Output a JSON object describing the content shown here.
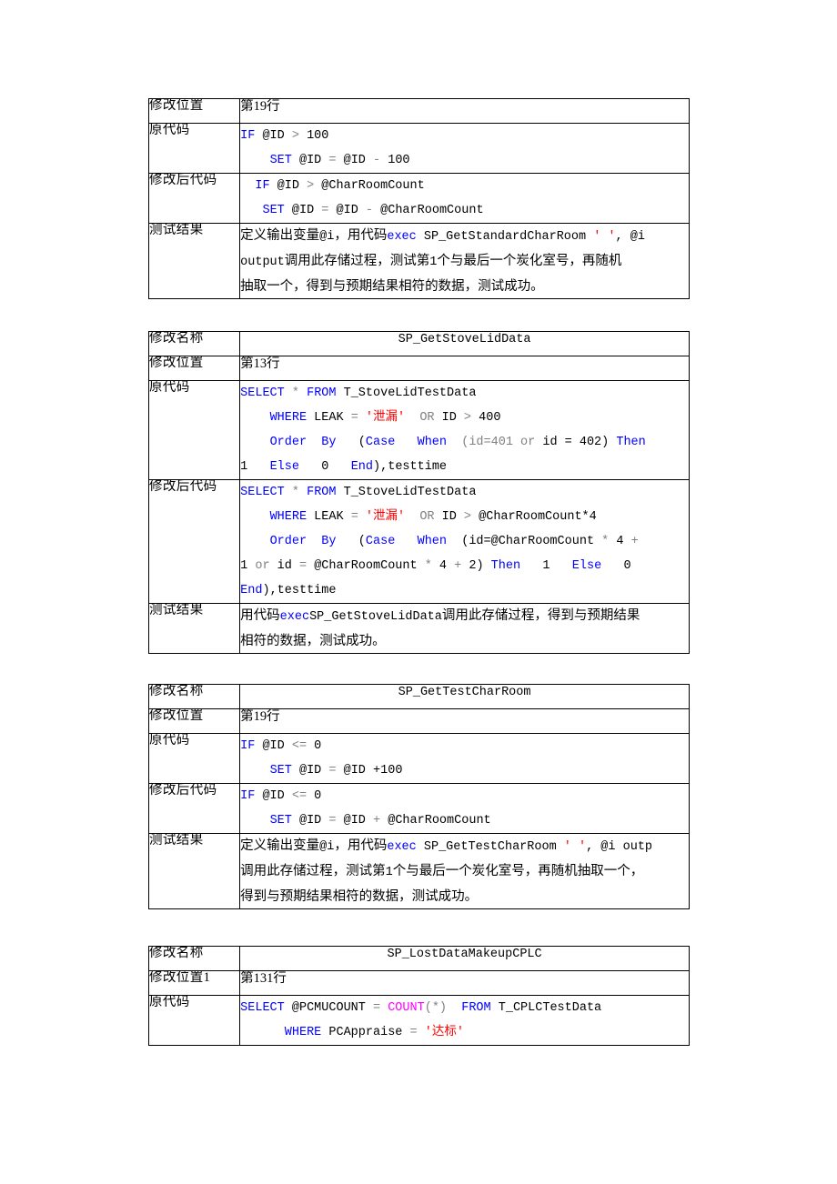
{
  "document": {
    "page_background": "#ffffff",
    "code_colors": {
      "keyword": "#0000ff",
      "string": "#ff0000",
      "operator": "#808080",
      "function": "#ff00ff",
      "plain": "#000000"
    }
  },
  "labels": {
    "name": "修改名称",
    "position": "修改位置",
    "position1": "修改位置1",
    "original_code": "原代码",
    "modified_code": "修改后代码",
    "test_result": "测试结果"
  },
  "tables": [
    {
      "id": "table-1",
      "rows": {
        "position_value": "第19行",
        "original_code_lines": [
          [
            {
              "t": "IF",
              "c": "kw"
            },
            {
              "t": " @ID ",
              "c": "txt"
            },
            {
              "t": ">",
              "c": "op"
            },
            {
              "t": " 100",
              "c": "txt"
            }
          ],
          [
            {
              "t": "    ",
              "c": "txt"
            },
            {
              "t": "SET",
              "c": "kw"
            },
            {
              "t": " @ID ",
              "c": "txt"
            },
            {
              "t": "=",
              "c": "op"
            },
            {
              "t": " @ID ",
              "c": "txt"
            },
            {
              "t": "-",
              "c": "op"
            },
            {
              "t": " 100",
              "c": "txt"
            }
          ]
        ],
        "modified_code_lines": [
          [
            {
              "t": "  ",
              "c": "txt"
            },
            {
              "t": "IF",
              "c": "kw"
            },
            {
              "t": " @ID ",
              "c": "txt"
            },
            {
              "t": ">",
              "c": "op"
            },
            {
              "t": " @CharRoomCount",
              "c": "txt"
            }
          ],
          [
            {
              "t": "   ",
              "c": "txt"
            },
            {
              "t": "SET",
              "c": "kw"
            },
            {
              "t": " @ID ",
              "c": "txt"
            },
            {
              "t": "=",
              "c": "op"
            },
            {
              "t": " @ID ",
              "c": "txt"
            },
            {
              "t": "-",
              "c": "op"
            },
            {
              "t": " @CharRoomCount",
              "c": "txt"
            }
          ]
        ],
        "test_result_lines": [
          [
            {
              "t": "定义输出变量",
              "k": "cn"
            },
            {
              "t": "@i",
              "k": "mono"
            },
            {
              "t": "，用代码",
              "k": "cn"
            },
            {
              "t": "exec",
              "k": "kw"
            },
            {
              "t": " SP_GetStandardCharRoom ",
              "k": "mono"
            },
            {
              "t": "' '",
              "k": "str"
            },
            {
              "t": ", @i",
              "k": "mono"
            }
          ],
          [
            {
              "t": "output",
              "k": "mono"
            },
            {
              "t": "调用此存储过程，测试第",
              "k": "cn"
            },
            {
              "t": "1",
              "k": "mono"
            },
            {
              "t": "个与最后一个炭化室号，再随机",
              "k": "cn"
            }
          ],
          [
            {
              "t": "抽取一个，得到与预期结果相符的数据，测试成功。",
              "k": "cn"
            }
          ]
        ]
      }
    },
    {
      "id": "table-2",
      "rows": {
        "name_value": "SP_GetStoveLidData",
        "position_value": "第13行",
        "original_code_lines": [
          [
            {
              "t": "SELECT",
              "c": "kw"
            },
            {
              "t": " ",
              "c": "txt"
            },
            {
              "t": "*",
              "c": "op"
            },
            {
              "t": " ",
              "c": "txt"
            },
            {
              "t": "FROM",
              "c": "kw"
            },
            {
              "t": " T_StoveLidTestData",
              "c": "txt"
            }
          ],
          [
            {
              "t": "    ",
              "c": "txt"
            },
            {
              "t": "WHERE",
              "c": "kw"
            },
            {
              "t": " LEAK ",
              "c": "txt"
            },
            {
              "t": "=",
              "c": "op"
            },
            {
              "t": " ",
              "c": "txt"
            },
            {
              "t": "'泄漏'",
              "c": "str"
            },
            {
              "t": "  ",
              "c": "txt"
            },
            {
              "t": "OR",
              "c": "op"
            },
            {
              "t": " ID ",
              "c": "txt"
            },
            {
              "t": ">",
              "c": "op"
            },
            {
              "t": " 400",
              "c": "txt"
            }
          ],
          [
            {
              "t": "    ",
              "c": "txt"
            },
            {
              "t": "Order",
              "c": "kw"
            },
            {
              "t": "  ",
              "c": "txt"
            },
            {
              "t": "By",
              "c": "kw"
            },
            {
              "t": "   (",
              "c": "txt"
            },
            {
              "t": "Case",
              "c": "kw"
            },
            {
              "t": "   ",
              "c": "txt"
            },
            {
              "t": "When",
              "c": "kw"
            },
            {
              "t": "  (",
              "c": "op"
            },
            {
              "t": "id=401",
              "c": "op"
            },
            {
              "t": " or ",
              "c": "op"
            },
            {
              "t": "id = 402",
              "c": "txt"
            },
            {
              "t": ") ",
              "c": "txt"
            },
            {
              "t": "Then",
              "c": "kw"
            }
          ],
          [
            {
              "t": "1",
              "c": "txt"
            },
            {
              "t": "   ",
              "c": "txt"
            },
            {
              "t": "Else",
              "c": "kw"
            },
            {
              "t": "   0",
              "c": "txt"
            },
            {
              "t": "   ",
              "c": "txt"
            },
            {
              "t": "End",
              "c": "kw"
            },
            {
              "t": "),testtime",
              "c": "txt"
            }
          ]
        ],
        "modified_code_lines": [
          [
            {
              "t": "SELECT",
              "c": "kw"
            },
            {
              "t": " ",
              "c": "txt"
            },
            {
              "t": "*",
              "c": "op"
            },
            {
              "t": " ",
              "c": "txt"
            },
            {
              "t": "FROM",
              "c": "kw"
            },
            {
              "t": " T_StoveLidTestData",
              "c": "txt"
            }
          ],
          [
            {
              "t": "    ",
              "c": "txt"
            },
            {
              "t": "WHERE",
              "c": "kw"
            },
            {
              "t": " LEAK ",
              "c": "txt"
            },
            {
              "t": "=",
              "c": "op"
            },
            {
              "t": " ",
              "c": "txt"
            },
            {
              "t": "'泄漏'",
              "c": "str"
            },
            {
              "t": "  ",
              "c": "txt"
            },
            {
              "t": "OR",
              "c": "op"
            },
            {
              "t": " ID ",
              "c": "txt"
            },
            {
              "t": ">",
              "c": "op"
            },
            {
              "t": " @CharRoomCount*4",
              "c": "txt"
            }
          ],
          [
            {
              "t": "    ",
              "c": "txt"
            },
            {
              "t": "Order",
              "c": "kw"
            },
            {
              "t": "  ",
              "c": "txt"
            },
            {
              "t": "By",
              "c": "kw"
            },
            {
              "t": "   (",
              "c": "txt"
            },
            {
              "t": "Case",
              "c": "kw"
            },
            {
              "t": "   ",
              "c": "txt"
            },
            {
              "t": "When",
              "c": "kw"
            },
            {
              "t": "  (id=@CharRoomCount ",
              "c": "txt"
            },
            {
              "t": "*",
              "c": "op"
            },
            {
              "t": " 4 ",
              "c": "txt"
            },
            {
              "t": "+",
              "c": "op"
            }
          ],
          [
            {
              "t": "1",
              "c": "txt"
            },
            {
              "t": " or ",
              "c": "op"
            },
            {
              "t": "id ",
              "c": "txt"
            },
            {
              "t": "=",
              "c": "op"
            },
            {
              "t": " @CharRoomCount ",
              "c": "txt"
            },
            {
              "t": "*",
              "c": "op"
            },
            {
              "t": " 4 ",
              "c": "txt"
            },
            {
              "t": "+",
              "c": "op"
            },
            {
              "t": " 2) ",
              "c": "txt"
            },
            {
              "t": "Then",
              "c": "kw"
            },
            {
              "t": "   1   ",
              "c": "txt"
            },
            {
              "t": "Else",
              "c": "kw"
            },
            {
              "t": "   0",
              "c": "txt"
            }
          ],
          [
            {
              "t": "End",
              "c": "kw"
            },
            {
              "t": "),testtime",
              "c": "txt"
            }
          ]
        ],
        "test_result_lines": [
          [
            {
              "t": "用代码",
              "k": "cn"
            },
            {
              "t": "exec",
              "k": "kw"
            },
            {
              "t": "SP_GetStoveLidData",
              "k": "mono"
            },
            {
              "t": "调用此存储过程，得到与预期结果",
              "k": "cn"
            }
          ],
          [
            {
              "t": "相符的数据，测试成功。",
              "k": "cn"
            }
          ]
        ]
      }
    },
    {
      "id": "table-3",
      "rows": {
        "name_value": "SP_GetTestCharRoom",
        "position_value": "第19行",
        "original_code_lines": [
          [
            {
              "t": "IF",
              "c": "kw"
            },
            {
              "t": " @ID ",
              "c": "txt"
            },
            {
              "t": "<=",
              "c": "op"
            },
            {
              "t": " 0",
              "c": "txt"
            }
          ],
          [
            {
              "t": "    ",
              "c": "txt"
            },
            {
              "t": "SET",
              "c": "kw"
            },
            {
              "t": " @ID ",
              "c": "txt"
            },
            {
              "t": "=",
              "c": "op"
            },
            {
              "t": " @ID ",
              "c": "txt"
            },
            {
              "t": "+100",
              "c": "txt"
            }
          ]
        ],
        "modified_code_lines": [
          [
            {
              "t": "IF",
              "c": "kw"
            },
            {
              "t": " @ID ",
              "c": "txt"
            },
            {
              "t": "<=",
              "c": "op"
            },
            {
              "t": " 0",
              "c": "txt"
            }
          ],
          [
            {
              "t": "    ",
              "c": "txt"
            },
            {
              "t": "SET",
              "c": "kw"
            },
            {
              "t": " @ID ",
              "c": "txt"
            },
            {
              "t": "=",
              "c": "op"
            },
            {
              "t": " @ID ",
              "c": "txt"
            },
            {
              "t": "+",
              "c": "op"
            },
            {
              "t": " @CharRoomCount",
              "c": "txt"
            }
          ]
        ],
        "test_result_lines": [
          [
            {
              "t": "定义输出变量",
              "k": "cn"
            },
            {
              "t": "@i",
              "k": "mono"
            },
            {
              "t": "，用代码",
              "k": "cn"
            },
            {
              "t": "exec",
              "k": "kw"
            },
            {
              "t": " SP_GetTestCharRoom ",
              "k": "mono"
            },
            {
              "t": "' '",
              "k": "str"
            },
            {
              "t": ", @i outp",
              "k": "mono"
            }
          ],
          [
            {
              "t": "调用此存储过程，测试第",
              "k": "cn"
            },
            {
              "t": "1",
              "k": "mono"
            },
            {
              "t": "个与最后一个炭化室号，再随机抽取一个，",
              "k": "cn"
            }
          ],
          [
            {
              "t": "得到与预期结果相符的数据，测试成功。",
              "k": "cn"
            }
          ]
        ]
      }
    },
    {
      "id": "table-4",
      "rows": {
        "name_value": "SP_LostDataMakeupCPLC",
        "position_value": "第131行",
        "original_code_lines": [
          [
            {
              "t": "SELECT",
              "c": "kw"
            },
            {
              "t": " @PCMUCOUNT ",
              "c": "txt"
            },
            {
              "t": "=",
              "c": "op"
            },
            {
              "t": " ",
              "c": "txt"
            },
            {
              "t": "COUNT",
              "c": "fn"
            },
            {
              "t": "(*)",
              "c": "op"
            },
            {
              "t": "  ",
              "c": "txt"
            },
            {
              "t": "FROM",
              "c": "kw"
            },
            {
              "t": " T_CPLCTestData",
              "c": "txt"
            }
          ],
          [
            {
              "t": "      ",
              "c": "txt"
            },
            {
              "t": "WHERE",
              "c": "kw"
            },
            {
              "t": " PCAppraise ",
              "c": "txt"
            },
            {
              "t": "=",
              "c": "op"
            },
            {
              "t": " ",
              "c": "txt"
            },
            {
              "t": "'达标'",
              "c": "str"
            }
          ]
        ]
      }
    }
  ]
}
